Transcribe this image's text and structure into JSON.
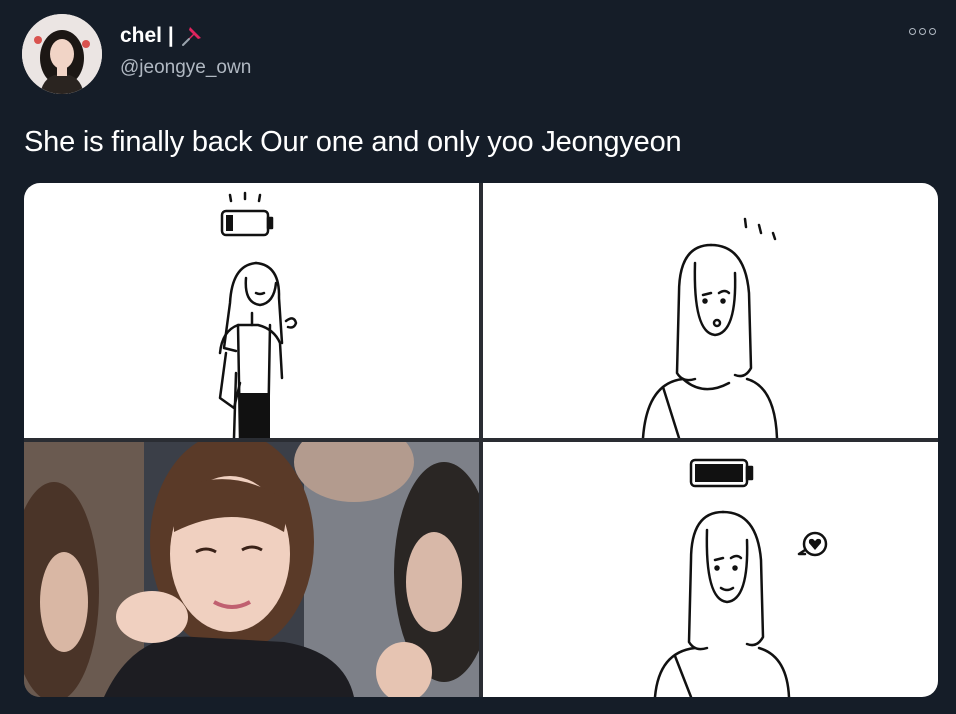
{
  "tweet": {
    "display_name": "chel |",
    "handle": "@jeongye_own",
    "text": "She is finally back Our one and only yoo Jeongyeon"
  },
  "icons": {
    "avatar": "profile-photo",
    "badge": "pushpin-icon",
    "more": "more-options-icon"
  },
  "media": {
    "panels": [
      {
        "depicts": "low-battery-sad-girl-illustration"
      },
      {
        "depicts": "confused-girl-illustration"
      },
      {
        "depicts": "smiling-person-photo"
      },
      {
        "depicts": "full-battery-happy-girl-illustration"
      }
    ]
  },
  "colors": {
    "background": "#151d28",
    "text": "#ffffff",
    "secondary_text": "#b0b8c2",
    "pin": "#e0245e"
  }
}
